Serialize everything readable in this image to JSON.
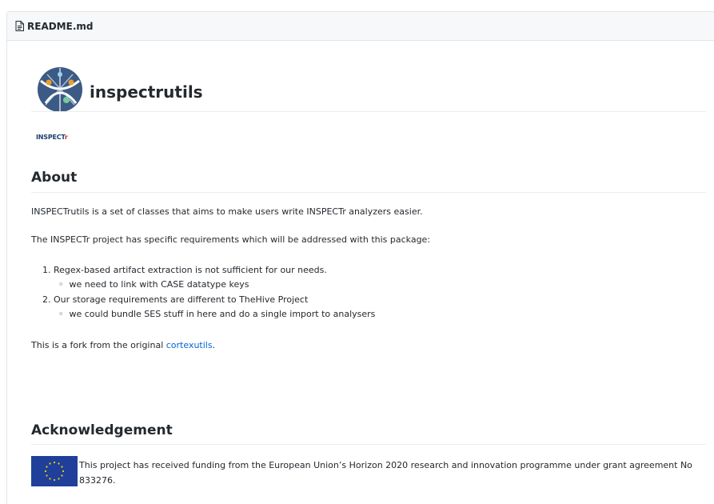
{
  "header": {
    "filename": "README.md",
    "icon": "file-icon"
  },
  "readme": {
    "logo_caption_a": "INSPECT",
    "logo_caption_b": "r",
    "title": "inspectrutils",
    "about": {
      "heading": "About",
      "intro": "INSPECTrutils is a set of classes that aims to make users write INSPECTr analyzers easier.",
      "requirements_intro": "The INSPECTr project has specific requirements which will be addressed with this package:",
      "items": [
        {
          "number": "1.",
          "text": "Regex-based artifact extraction is not sufficient for our needs.",
          "sub": "we need to link with CASE datatype keys"
        },
        {
          "number": "2.",
          "text": "Our storage requirements are different to TheHive Project",
          "sub": "we could bundle SES stuff in here and do a single import to analysers"
        }
      ],
      "fork_prefix": "This is a fork from the original ",
      "fork_link": "cortexutils",
      "fork_suffix": "."
    },
    "acknowledgement": {
      "heading": "Acknowledgement",
      "text": "This project has received funding from the European Union’s Horizon 2020 research and innovation programme under grant agreement No 833276."
    }
  },
  "colors": {
    "link": "#0366d6",
    "eu_blue": "#1f3f9a",
    "eu_gold": "#f5d300"
  }
}
